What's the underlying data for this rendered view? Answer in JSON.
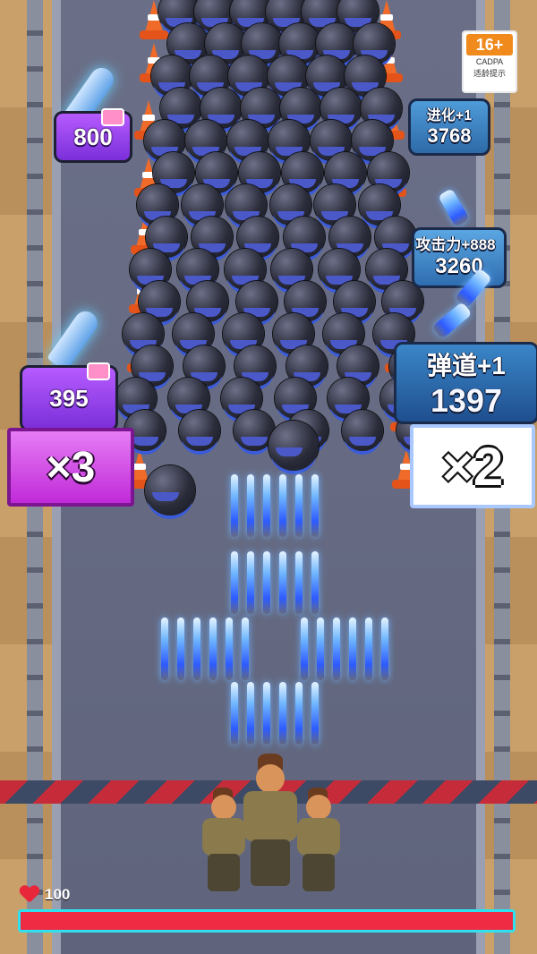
{
  "rating": {
    "age": "16+",
    "org": "CADPA",
    "tip": "适龄提示"
  },
  "pickups_left": [
    {
      "value": "800"
    },
    {
      "value": "395"
    }
  ],
  "pickups_right": [
    {
      "label": "进化+1",
      "value": "3768"
    },
    {
      "label": "攻击力+888",
      "value": "3260"
    },
    {
      "label": "弹道+1",
      "value": "1397"
    }
  ],
  "gates": {
    "left": "×3",
    "right": "×2"
  },
  "player": {
    "hp_text": "100",
    "hp_fraction": 1.0
  },
  "colors": {
    "hp_fill": "#ef2b44",
    "hp_border": "#2fe0ef",
    "gate_left": "#c02ad8",
    "danger_stripe": "#c62b3a"
  },
  "icons": [
    "heart-icon",
    "rocket-icon",
    "bullet-icon",
    "video-ad-icon",
    "traffic-cone-icon"
  ]
}
